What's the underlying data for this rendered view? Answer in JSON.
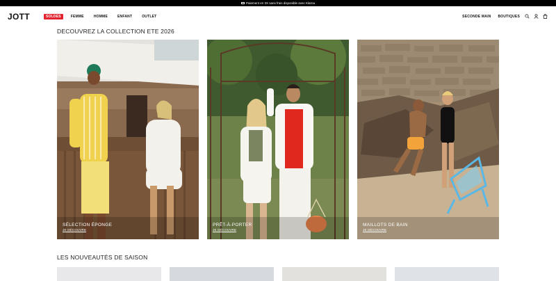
{
  "promo": {
    "text": "Paiement en 3X sans frais disponible avec Klarna"
  },
  "header": {
    "logo": "JOTT",
    "soldes": "SOLDES",
    "nav": [
      "FEMME",
      "HOMME",
      "ENFANT",
      "OUTLET"
    ],
    "nav_right": [
      "SECONDE MAIN",
      "BOUTIQUES"
    ],
    "icons": [
      "search-icon",
      "account-icon",
      "cart-icon"
    ]
  },
  "collection": {
    "title": "DECOUVREZ LA COLLECTION ETE 2026",
    "cards": [
      {
        "title": "SÉLECTION ÉPONGE",
        "cta": "JE DÉCOUVRE"
      },
      {
        "title": "PRÊT-À-PORTER",
        "cta": "JE DÉCOUVRE"
      },
      {
        "title": "MAILLOTS DE BAIN",
        "cta": "JE DÉCOUVRE"
      }
    ]
  },
  "new_season": {
    "title": "LES NOUVEAUTÉS DE SAISON",
    "colors": [
      "#e8e8ea",
      "#d6d9de",
      "#e3e1de",
      "#dfe2e6"
    ]
  }
}
